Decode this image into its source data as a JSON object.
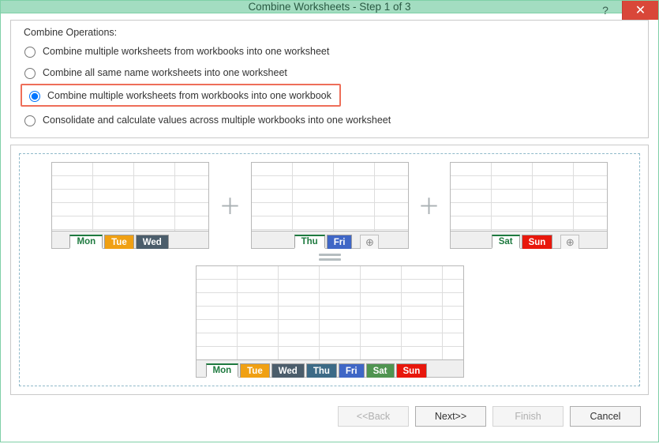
{
  "window": {
    "title": "Combine Worksheets - Step 1 of 3",
    "help_icon": "?",
    "close_icon": "✕"
  },
  "fieldset": {
    "legend": "Combine Operations:",
    "options": {
      "opt1": "Combine multiple worksheets from workbooks into one worksheet",
      "opt2": "Combine all same name worksheets into one worksheet",
      "opt3": "Combine multiple worksheets from workbooks into one workbook",
      "opt4": "Consolidate and calculate values across multiple workbooks into one worksheet"
    },
    "selected": "opt3"
  },
  "illustration": {
    "book_a_tabs": [
      "Mon",
      "Tue",
      "Wed"
    ],
    "book_b_tabs": [
      "Thu",
      "Fri"
    ],
    "book_c_tabs": [
      "Sat",
      "Sun"
    ],
    "result_tabs": [
      "Mon",
      "Tue",
      "Wed",
      "Thu",
      "Fri",
      "Sat",
      "Sun"
    ],
    "plus": "＋",
    "equals": "═══",
    "plus_tab": "⊕"
  },
  "buttons": {
    "back": "<<Back",
    "next": "Next>>",
    "finish": "Finish",
    "cancel": "Cancel"
  }
}
